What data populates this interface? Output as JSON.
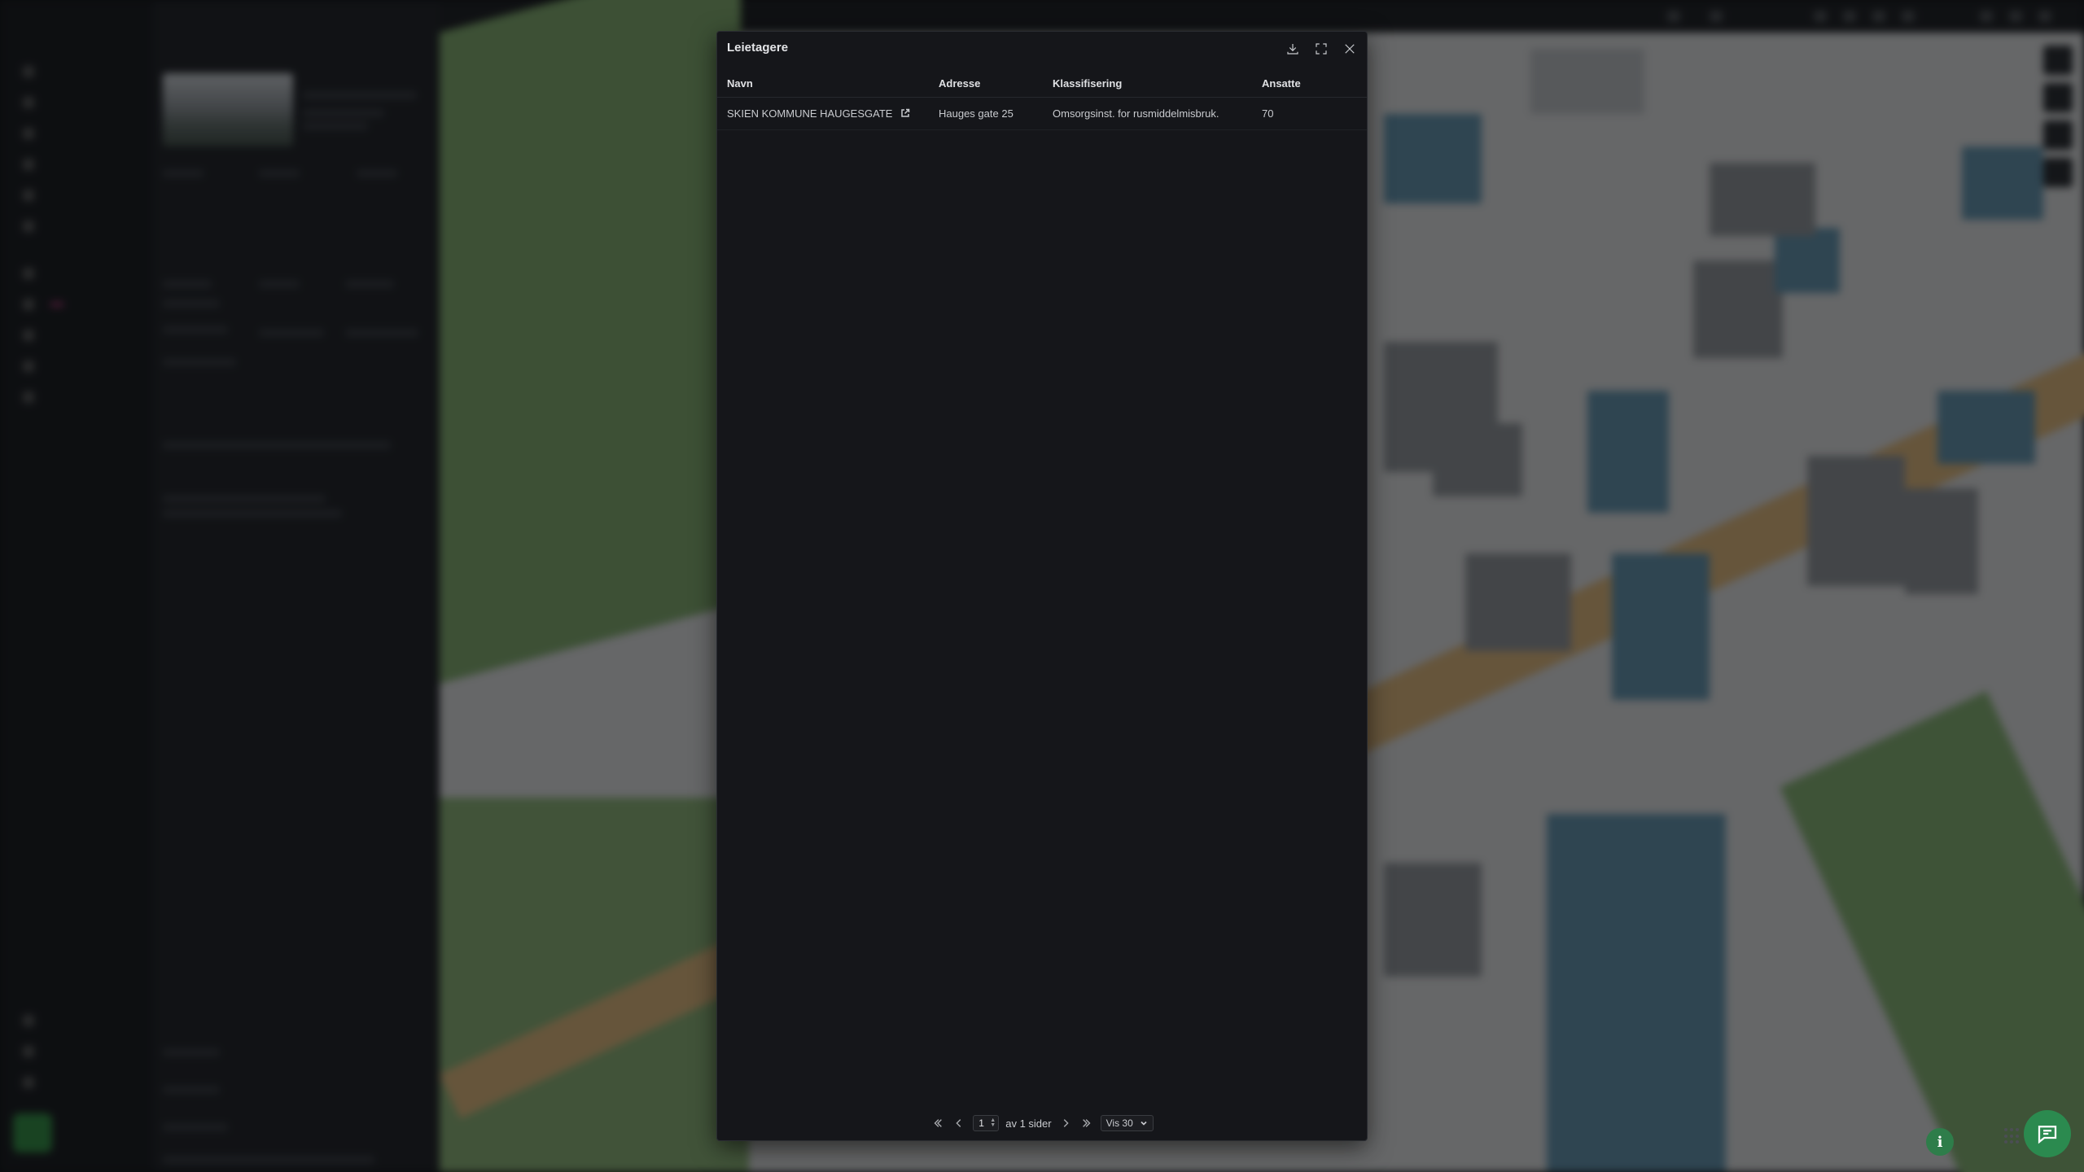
{
  "dialog": {
    "title": "Leietagere",
    "columns": {
      "name": "Navn",
      "address": "Adresse",
      "classification": "Klassifisering",
      "employees": "Ansatte"
    },
    "rows": [
      {
        "name": "SKIEN KOMMUNE HAUGESGATE",
        "address": "Hauges gate 25",
        "classification": "Omsorgsinst. for rusmiddelmisbruk.",
        "employees": "70"
      }
    ],
    "pagination": {
      "current_page": "1",
      "of_pages_text": "av 1 sider",
      "page_size_label": "Vis 30"
    },
    "icons": {
      "download": "download-icon",
      "expand": "expand-icon",
      "close": "close-icon",
      "external_link": "external-link-icon"
    }
  },
  "floating": {
    "info_label": "i"
  },
  "colors": {
    "dialog_bg": "#15161a",
    "accent_green": "#2b8a4f"
  }
}
